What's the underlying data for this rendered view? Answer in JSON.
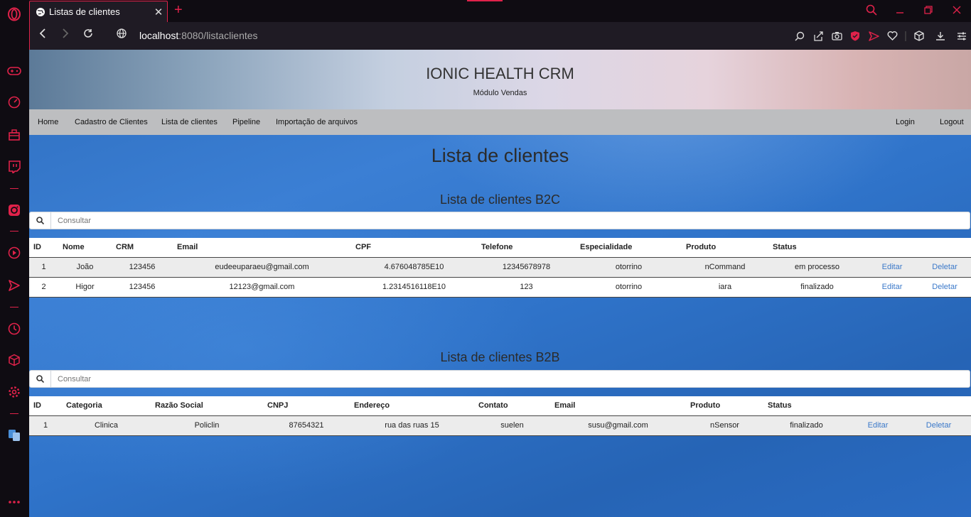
{
  "browser": {
    "tab_title": "Listas de clientes",
    "url_host": "localhost",
    "url_rest": ":8080/listaclientes"
  },
  "header": {
    "app_title": "IONIC HEALTH CRM",
    "app_subtitle": "Módulo Vendas"
  },
  "nav": {
    "home": "Home",
    "cadastro": "Cadastro de Clientes",
    "lista": "Lista de clientes",
    "pipeline": "Pipeline",
    "importacao": "Importação de arquivos",
    "login": "Login",
    "logout": "Logout"
  },
  "main": {
    "title": "Lista de clientes",
    "b2c": {
      "title": "Lista de clientes B2C",
      "search_placeholder": "Consultar",
      "columns": [
        "ID",
        "Nome",
        "CRM",
        "Email",
        "CPF",
        "Telefone",
        "Especialidade",
        "Produto",
        "Status"
      ],
      "rows": [
        {
          "id": "1",
          "nome": "João",
          "crm": "123456",
          "email": "eudeeuparaeu@gmail.com",
          "cpf": "4.676048785E10",
          "telefone": "12345678978",
          "especialidade": "otorrino",
          "produto": "nCommand",
          "status": "em processo",
          "editar": "Editar",
          "deletar": "Deletar"
        },
        {
          "id": "2",
          "nome": "Higor",
          "crm": "123456",
          "email": "12123@gmail.com",
          "cpf": "1.2314516118E10",
          "telefone": "123",
          "especialidade": "otorrino",
          "produto": "iara",
          "status": "finalizado",
          "editar": "Editar",
          "deletar": "Deletar"
        }
      ]
    },
    "b2b": {
      "title": "Lista de clientes B2B",
      "search_placeholder": "Consultar",
      "columns": [
        "ID",
        "Categoria",
        "Razão Social",
        "CNPJ",
        "Endereço",
        "Contato",
        "Email",
        "Produto",
        "Status"
      ],
      "rows": [
        {
          "id": "1",
          "categoria": "Clinica",
          "razao": "Policlin",
          "cnpj": "87654321",
          "endereco": "rua das ruas 15",
          "contato": "suelen",
          "email": "susu@gmail.com",
          "produto": "nSensor",
          "status": "finalizado",
          "editar": "Editar",
          "deletar": "Deletar"
        }
      ]
    }
  },
  "colors": {
    "opera_accent": "#e0224a",
    "link": "#3a78c9"
  }
}
